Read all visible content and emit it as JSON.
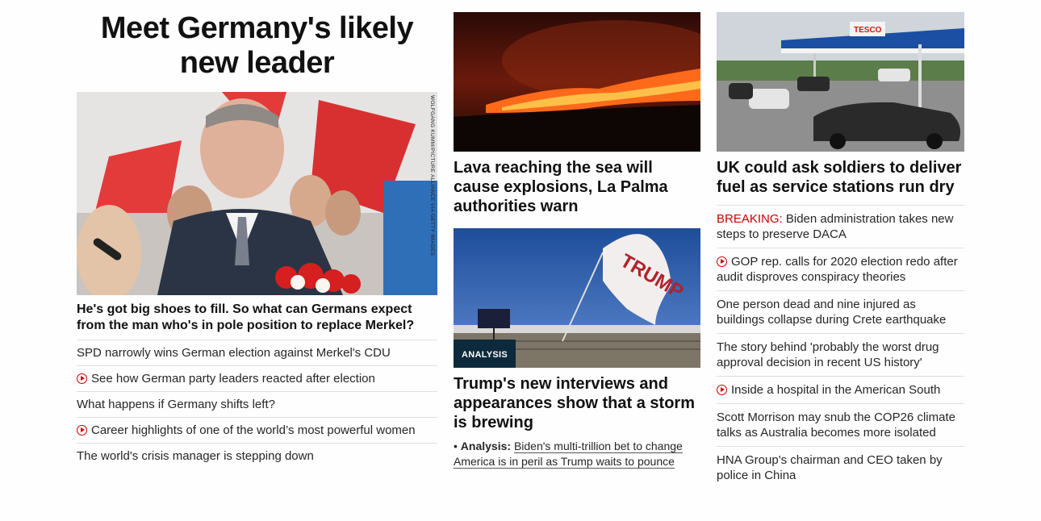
{
  "lead": {
    "title": "Meet Germany's likely new leader",
    "image_credit": "WOLFGANG KUMM/PICTURE ALLIANCE VIA GETTY IMAGES",
    "headline": "He's got big shoes to fill. So what can Germans expect from the man who's in pole position to replace Merkel?",
    "links": [
      {
        "text": "SPD narrowly wins German election against Merkel's CDU",
        "video": false
      },
      {
        "text": "See how German party leaders reacted after election",
        "video": true
      },
      {
        "text": "What happens if Germany shifts left?",
        "video": false
      },
      {
        "text": "Career highlights of one of the world’s most powerful women",
        "video": true
      },
      {
        "text": "The world's crisis manager is stepping down",
        "video": false
      }
    ]
  },
  "middle": {
    "story1": {
      "headline": "Lava reaching the sea will cause explosions, La Palma authorities warn"
    },
    "story2": {
      "badge": "ANALYSIS",
      "headline": "Trump's new interviews and appearances show that a storm is brewing",
      "related_label": "Analysis:",
      "related_text": "Biden's multi-trillion bet to change America is in peril as Trump waits to pounce"
    }
  },
  "right": {
    "headline": "UK could ask soldiers to deliver fuel as service stations run dry",
    "breaking_label": "BREAKING:",
    "links": [
      {
        "text": "Biden administration takes new steps to preserve DACA",
        "video": false
      },
      {
        "text": "GOP rep. calls for 2020 election redo after audit disproves conspiracy theories",
        "video": true
      },
      {
        "text": "One person dead and nine injured as buildings collapse during Crete earthquake",
        "video": false
      },
      {
        "text": "The story behind 'probably the worst drug approval decision in recent US history'",
        "video": false
      },
      {
        "text": "Inside a hospital in the American South",
        "video": true
      },
      {
        "text": "Scott Morrison may snub the COP26 climate talks as Australia becomes more isolated",
        "video": false
      },
      {
        "text": "HNA Group's chairman and CEO taken by police in China",
        "video": false
      }
    ]
  },
  "colors": {
    "accent_red": "#cc0000",
    "badge_bg": "#0c2a3b",
    "divider": "#dedede"
  }
}
